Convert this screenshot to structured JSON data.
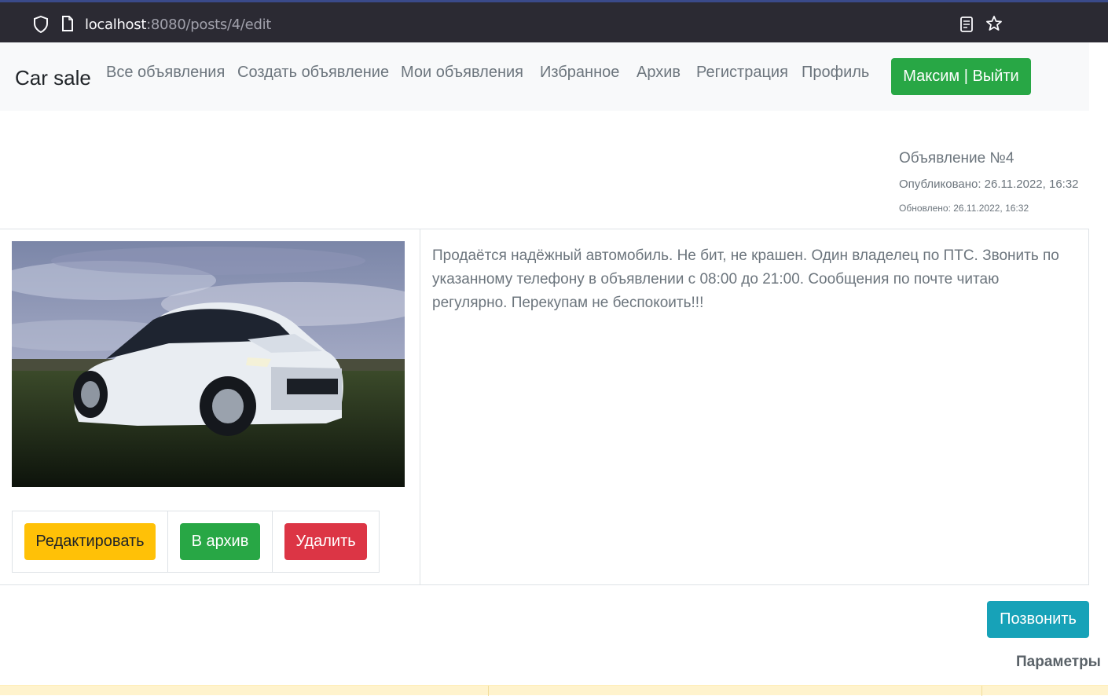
{
  "browser": {
    "url_host": "localhost",
    "url_rest": ":8080/posts/4/edit"
  },
  "navbar": {
    "brand": "Car sale",
    "links": [
      "Все объявления",
      "Создать объявление",
      "Мои объявления",
      "Избранное",
      "Архив",
      "Регистрация",
      "Профиль"
    ],
    "logout_label": "Максим | Выйти"
  },
  "post": {
    "title": "Объявление №4",
    "published": "Опубликовано: 26.11.2022, 16:32",
    "updated": "Обновлено: 26.11.2022, 16:32",
    "description": "Продаётся надёжный автомобиль. Не бит, не крашен. Один владелец по ПТС. Звонить по указанному телефону в объявлении с 08:00 до 21:00. Сообщения по почте читаю регулярно. Перекупам не беспокоить!!!",
    "photo_alt": "white-sedan-photo"
  },
  "actions": {
    "edit_label": "Редактировать",
    "archive_label": "В архив",
    "delete_label": "Удалить"
  },
  "call_label": "Позвонить",
  "params_label": "Параметры",
  "colors": {
    "success": "#28a745",
    "warning": "#ffc107",
    "danger": "#dc3545",
    "info": "#17a2b8",
    "muted": "#6c757d"
  }
}
